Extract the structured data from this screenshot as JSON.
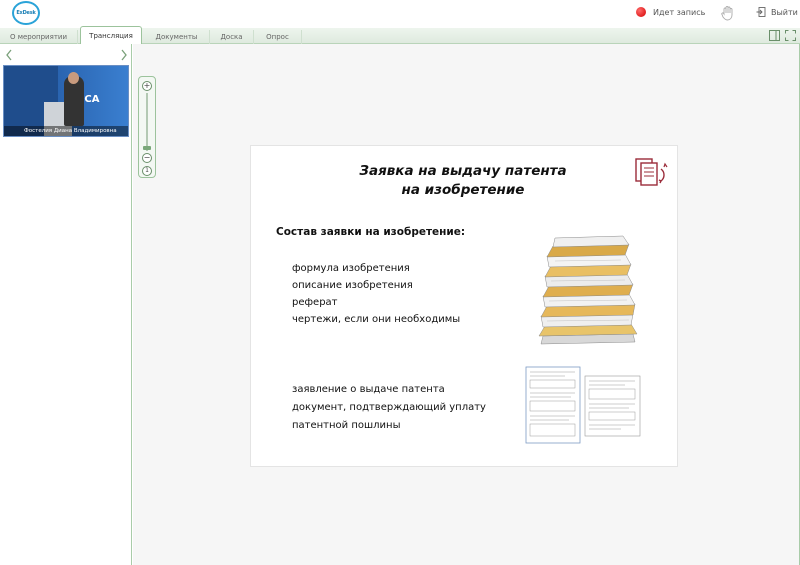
{
  "header": {
    "logo_text": "ExDesk",
    "recording_label": "Идет запись",
    "exit_label": "Выйти"
  },
  "tabs": [
    {
      "label": "О мероприятии",
      "active": false
    },
    {
      "label": "Трансляция",
      "active": true
    },
    {
      "label": "Документы",
      "active": false
    },
    {
      "label": "Доска",
      "active": false
    },
    {
      "label": "Опрос",
      "active": false
    }
  ],
  "video": {
    "sign_text": "ИСА",
    "speaker_name": "Фостелия Диана Владимировна"
  },
  "slide": {
    "title_line1": "Заявка на выдачу патента",
    "title_line2": "на изобретение",
    "subtitle": "Состав заявки на изобретение:",
    "list_items": [
      "формула изобретения",
      "описание изобретения",
      "реферат",
      "чертежи, если они необходимы"
    ],
    "list_items_2": [
      "заявление о выдаче патента",
      "документ, подтверждающий уплату",
      "патентной пошлины"
    ]
  },
  "colors": {
    "accent_green": "#9cc39c",
    "record_red": "#d40000",
    "slide_icon": "#9b2c3a"
  }
}
